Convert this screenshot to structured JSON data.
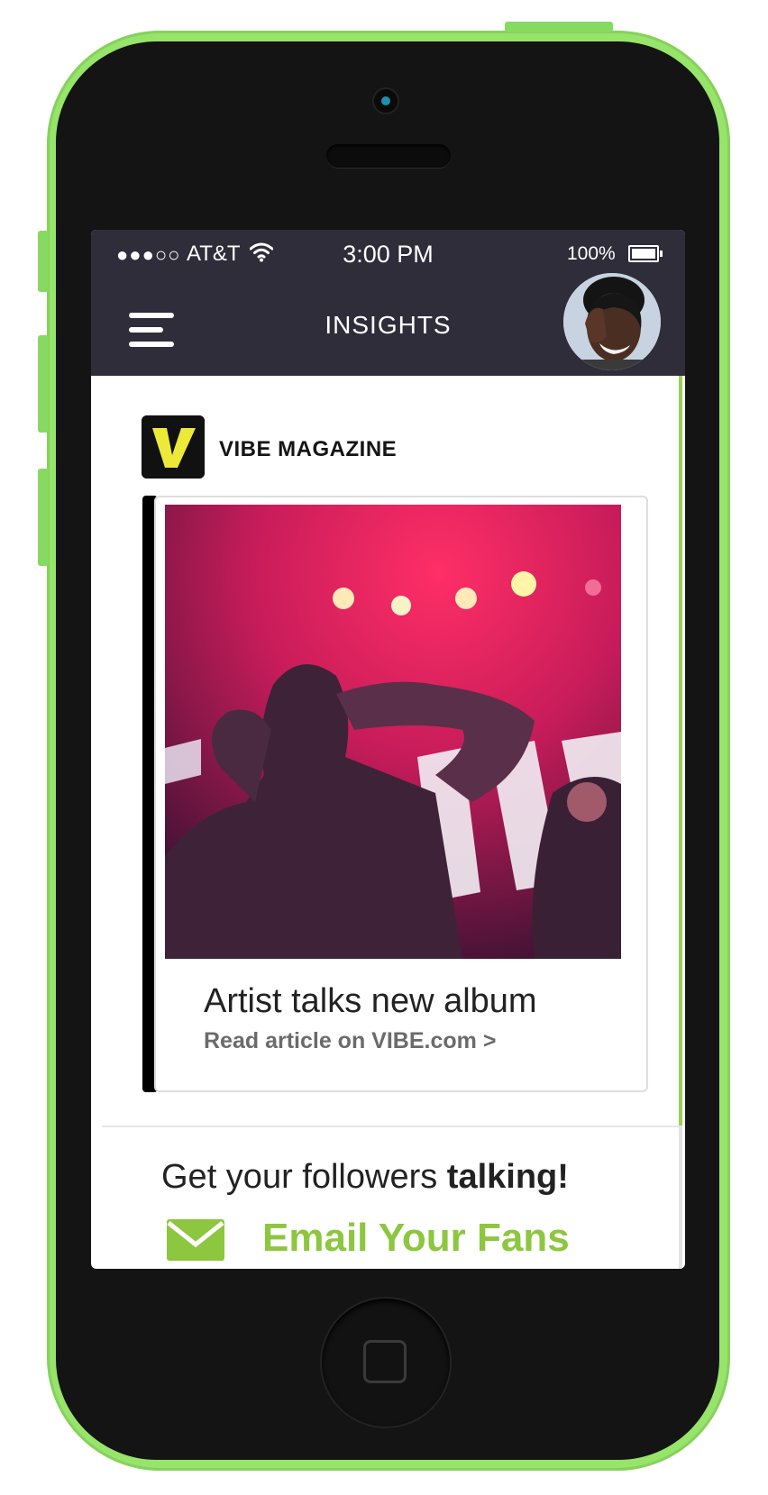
{
  "status_bar": {
    "signal": "●●●○○",
    "carrier": "AT&T",
    "time": "3:00 PM",
    "battery": "100%"
  },
  "header": {
    "title": "INSIGHTS"
  },
  "feed": {
    "source": {
      "logo_letter": "V",
      "name": "VIBE MAGAZINE"
    },
    "article": {
      "title": "Artist talks new album",
      "link": "Read article on VIBE.com >"
    }
  },
  "cta": {
    "text_prefix": "Get your followers ",
    "text_bold": "talking!",
    "button_label": "Email Your Fans"
  },
  "colors": {
    "device_green": "#97e46a",
    "header_bg": "#2f2d3a",
    "accent_green": "#8dc63f",
    "logo_yellow": "#ece939"
  },
  "icons": [
    "menu-icon",
    "wifi-icon",
    "battery-icon",
    "envelope-icon",
    "vibe-logo"
  ]
}
